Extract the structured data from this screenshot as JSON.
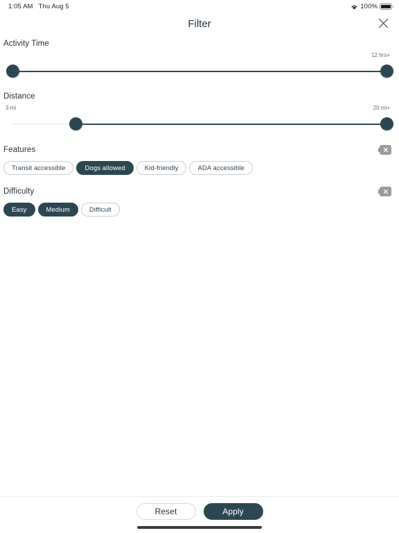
{
  "status_bar": {
    "time": "1:05 AM",
    "date": "Thu Aug 5",
    "wifi_icon": "wifi-icon",
    "battery_percent": "100%",
    "battery_icon": "battery-icon"
  },
  "header": {
    "title": "Filter",
    "close_icon": "close-icon"
  },
  "theme": {
    "accent": "#2d4752",
    "muted_text": "#5d6a72",
    "chip_border": "#c9ced3",
    "track": "#eceef0",
    "clear_chip": "#9a9a9e"
  },
  "sections": {
    "activity_time": {
      "title": "Activity Time",
      "min_label": "",
      "max_label": "12 hrs+",
      "thumb_left_pct": 0,
      "thumb_right_pct": 100,
      "range_start_pct": 0,
      "range_end_pct": 100
    },
    "distance": {
      "title": "Distance",
      "min_label": "3 mi",
      "max_label": "20 mi+",
      "thumb_left_pct": 17,
      "thumb_right_pct": 100,
      "range_start_pct": 17,
      "range_end_pct": 100
    },
    "features": {
      "title": "Features",
      "clear_icon": "clear-icon",
      "chips": [
        {
          "label": "Transit accessible",
          "selected": false
        },
        {
          "label": "Dogs allowed",
          "selected": true
        },
        {
          "label": "Kid-friendly",
          "selected": false
        },
        {
          "label": "ADA accessible",
          "selected": false
        }
      ]
    },
    "difficulty": {
      "title": "Difficulty",
      "clear_icon": "clear-icon",
      "chips": [
        {
          "label": "Easy",
          "selected": true
        },
        {
          "label": "Medium",
          "selected": true
        },
        {
          "label": "Difficult",
          "selected": false
        }
      ]
    }
  },
  "footer": {
    "reset_label": "Reset",
    "apply_label": "Apply"
  }
}
